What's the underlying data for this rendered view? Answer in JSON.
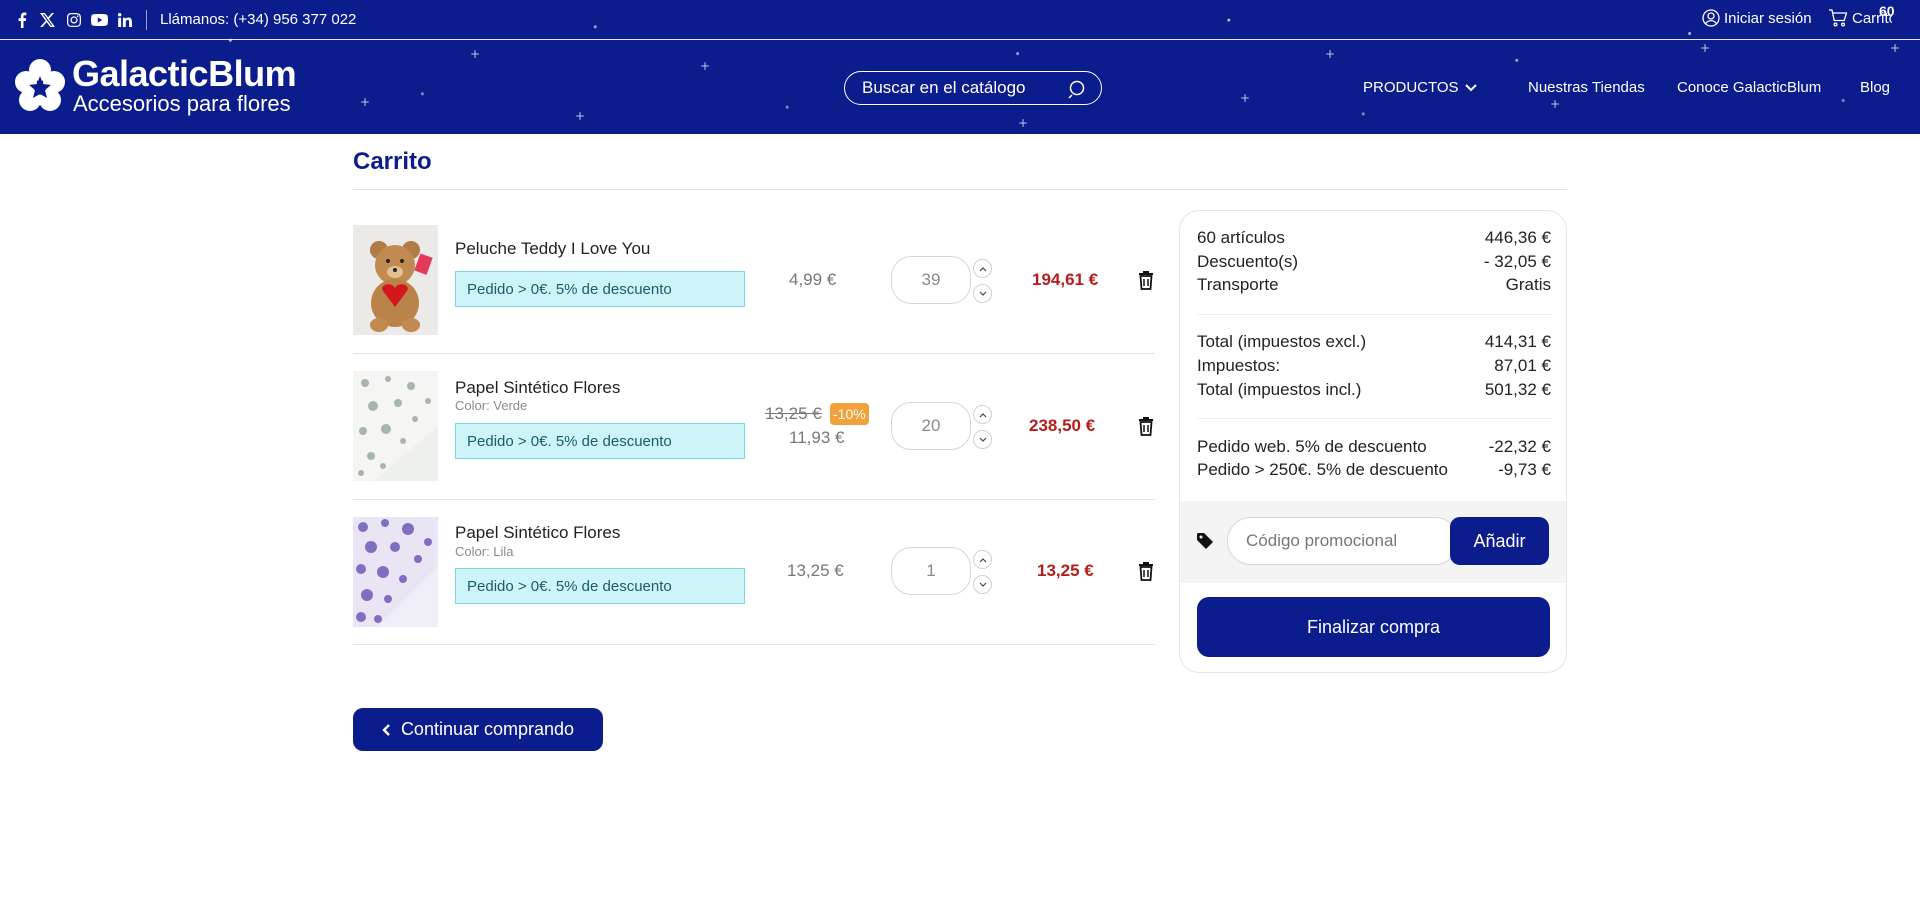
{
  "topbar": {
    "social": [
      "facebook-icon",
      "x-icon",
      "instagram-icon",
      "youtube-icon",
      "linkedin-icon"
    ],
    "phone": "Llámanos: (+34) 956 377 022",
    "login": "Iniciar sesión",
    "cart_label": "Carrito",
    "cart_count": "60"
  },
  "header": {
    "brand": "GalacticBlum",
    "tagline": "Accesorios para flores",
    "search_placeholder": "Buscar en el catálogo",
    "nav": [
      "PRODUCTOS",
      "Nuestras Tiendas",
      "Conoce GalacticBlum",
      "Blog"
    ]
  },
  "colors": {
    "primary": "#0b1c8c",
    "price_red": "#b51d1d",
    "promo_bg": "#cdf4f8",
    "discount_badge": "#f2a03a"
  },
  "page": {
    "title": "Carrito"
  },
  "cart": {
    "items": [
      {
        "name": "Peluche Teddy I Love You",
        "attribute": "",
        "promo": "Pedido > 0€. 5% de descuento",
        "old_price": "",
        "discount": "",
        "price": "4,99 €",
        "quantity": "39",
        "total": "194,61 €"
      },
      {
        "name": "Papel Sintético Flores",
        "attribute": "Color: Verde",
        "promo": "Pedido > 0€. 5% de descuento",
        "old_price": "13,25 €",
        "discount": "-10%",
        "price": "11,93 €",
        "quantity": "20",
        "total": "238,50 €"
      },
      {
        "name": "Papel Sintético Flores",
        "attribute": "Color: Lila",
        "promo": "Pedido > 0€. 5% de descuento",
        "old_price": "",
        "discount": "",
        "price": "13,25 €",
        "quantity": "1",
        "total": "13,25 €"
      }
    ],
    "continue_label": "Continuar comprando"
  },
  "summary": {
    "articles_label": "60 artículos",
    "articles_value": "446,36 €",
    "discounts_label": "Descuento(s)",
    "discounts_value": "- 32,05 €",
    "shipping_label": "Transporte",
    "shipping_value": "Gratis",
    "total_excl_label": "Total (impuestos excl.)",
    "total_excl_value": "414,31 €",
    "taxes_label": "Impuestos:",
    "taxes_value": "87,01 €",
    "total_incl_label": "Total (impuestos incl.)",
    "total_incl_value": "501,32 €",
    "rule1_label": "Pedido web. 5% de descuento",
    "rule1_value": "-22,32 €",
    "rule2_label": "Pedido > 250€. 5% de descuento",
    "rule2_value": "-9,73 €",
    "voucher_placeholder": "Código promocional",
    "voucher_button": "Añadir",
    "checkout_button": "Finalizar compra"
  }
}
